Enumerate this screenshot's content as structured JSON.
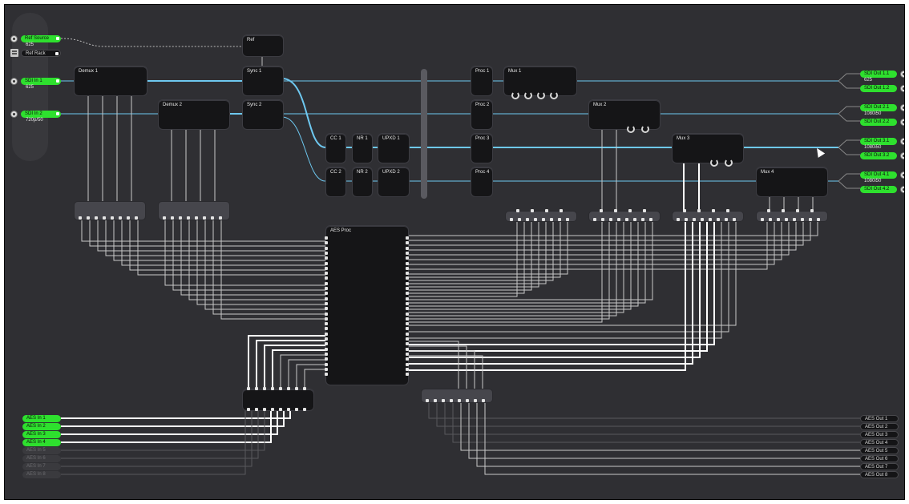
{
  "inputs": {
    "ref_source": {
      "label": "Ref Source",
      "format": "625"
    },
    "ref_rack": {
      "label": "Ref Rack"
    },
    "sdi_in_1": {
      "label": "SDI In 1",
      "format": "625"
    },
    "sdi_in_2": {
      "label": "SDI In 2",
      "format": "720p/50"
    }
  },
  "blocks": {
    "ref": "Ref",
    "demux1": "Demux 1",
    "demux2": "Demux 2",
    "sync1": "Sync 1",
    "sync2": "Sync 2",
    "cc1": "CC 1",
    "cc2": "CC 2",
    "nr1": "NR 1",
    "nr2": "NR 2",
    "upxd1": "UPXD 1",
    "upxd2": "UPXD 2",
    "proc1": "Proc 1",
    "proc2": "Proc 2",
    "proc3": "Proc 3",
    "proc4": "Proc 4",
    "mux1": "Mux 1",
    "mux2": "Mux 2",
    "mux3": "Mux 3",
    "mux4": "Mux 4",
    "aes_proc": "AES Proc"
  },
  "outputs": [
    {
      "a": "SDI Out 1.1",
      "b": "SDI Out 1.2",
      "format": "625"
    },
    {
      "a": "SDI Out 2.1",
      "b": "SDI Out 2.2",
      "format": "1080i50"
    },
    {
      "a": "SDI Out 3.1",
      "b": "SDI Out 3.2",
      "format": "1080i50"
    },
    {
      "a": "SDI Out 4.1",
      "b": "SDI Out 4.2",
      "format": "1080i50"
    }
  ],
  "aes_in": [
    "AES In 1",
    "AES In 2",
    "AES In 3",
    "AES In 4",
    "AES In 5",
    "AES In 6",
    "AES In 7",
    "AES In 8"
  ],
  "aes_out": [
    "AES Out 1",
    "AES Out 2",
    "AES Out 3",
    "AES Out 4",
    "AES Out 5",
    "AES Out 6",
    "AES Out 7",
    "AES Out 8"
  ],
  "colors": {
    "background": "#2f2f33",
    "video_wire": "#6ec8f0",
    "audio_wire": "#c8c8c8",
    "active_input": "#2ee02e",
    "block": "#151517"
  }
}
